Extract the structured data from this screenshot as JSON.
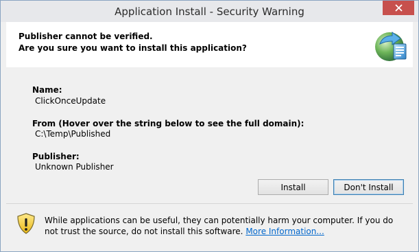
{
  "window": {
    "title": "Application Install - Security Warning"
  },
  "header": {
    "line1": "Publisher cannot be verified.",
    "line2": "Are you sure you want to install this application?",
    "icon": "clickonce-app-icon"
  },
  "details": {
    "name_label": "Name:",
    "name_value": "ClickOnceUpdate",
    "from_label": "From (Hover over the string below to see the full domain):",
    "from_value": "C:\\Temp\\Published",
    "publisher_label": "Publisher:",
    "publisher_value": "Unknown Publisher"
  },
  "buttons": {
    "install_label": "Install",
    "dont_install_label": "Don't Install"
  },
  "footer": {
    "warning_text": "While applications can be useful, they can potentially harm your computer. If you do not trust the source, do not install this software.",
    "link_text": "More Information...",
    "icon": "shield-warning-icon"
  },
  "colors": {
    "close_button": "#c7504d",
    "link": "#0066cc",
    "default_button_border": "#3c7fb1"
  }
}
